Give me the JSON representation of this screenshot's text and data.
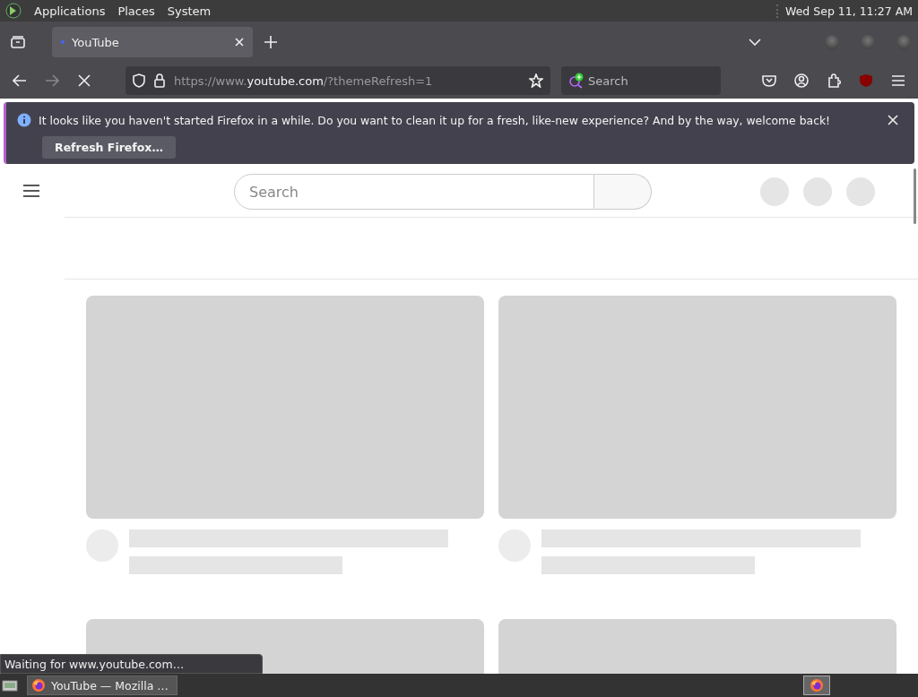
{
  "top_panel": {
    "menus": [
      "Applications",
      "Places",
      "System"
    ],
    "clock": "Wed Sep 11, 11:27 AM"
  },
  "tabs": [
    {
      "title": "YouTube",
      "selected": true
    }
  ],
  "nav": {
    "forward_disabled": true,
    "url": {
      "before": "https://www.",
      "domain": "youtube.com",
      "after": "/?themeRefresh=1"
    },
    "search_placeholder": "Search"
  },
  "notification": {
    "message": "It looks like you haven't started Firefox in a while. Do you want to clean it up for a fresh, like-new experience? And by the way, welcome back!",
    "button": "Refresh Firefox…"
  },
  "page": {
    "search_placeholder": "Search"
  },
  "status_text": "Waiting for www.youtube.com…",
  "taskbar": {
    "tasks": [
      {
        "title": "YouTube — Mozilla …",
        "selected": false
      }
    ]
  }
}
